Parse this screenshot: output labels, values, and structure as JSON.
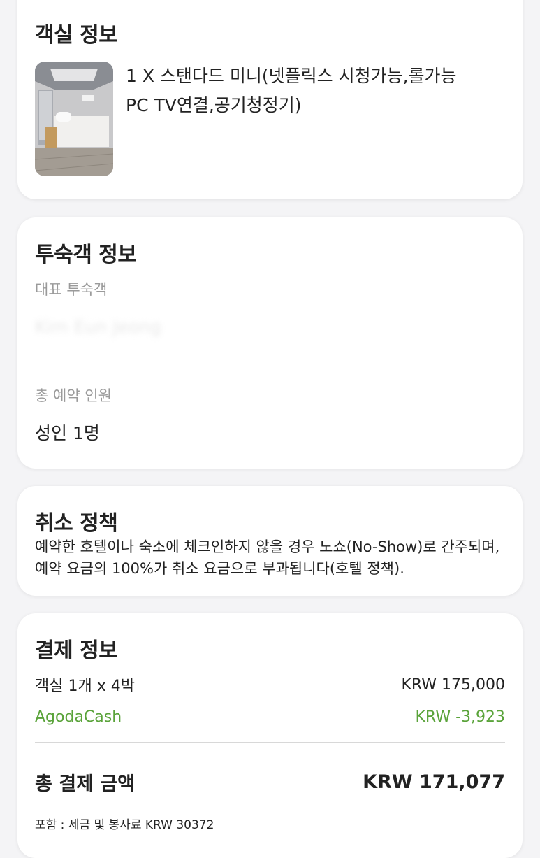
{
  "room_info": {
    "title": "객실 정보",
    "description_line1": "1 X 스탠다드 미니(넷플릭스 시청가능,롤가능",
    "description_line2": "PC TV연결,공기청정기)"
  },
  "guest_info": {
    "title": "투숙객 정보",
    "main_guest_label": "대표 투숙객",
    "main_guest_value": "Kim Eun Jeong",
    "total_guests_label": "총 예약 인원",
    "total_guests_value": "성인 1명"
  },
  "cancel_policy": {
    "title": "취소 정책",
    "text": "예약한 호텔이나 숙소에 체크인하지 않을 경우 노쇼(No-Show)로 간주되며, 예약 요금의 100%가 취소 요금으로 부과됩니다(호텔 정책)."
  },
  "payment_info": {
    "title": "결제 정보",
    "room_line_label": "객실 1개 x 4박",
    "room_line_value": "KRW 175,000",
    "agodacash_label": "AgodaCash",
    "agodacash_value": "KRW -3,923",
    "total_label": "총 결제 금액",
    "total_value": "KRW 171,077",
    "tax_note": "포함 : 세금 및 봉사료 KRW 30372"
  },
  "colors": {
    "accent_green": "#5aa33a",
    "card_bg": "#ffffff",
    "page_bg": "#f4f4f6"
  }
}
